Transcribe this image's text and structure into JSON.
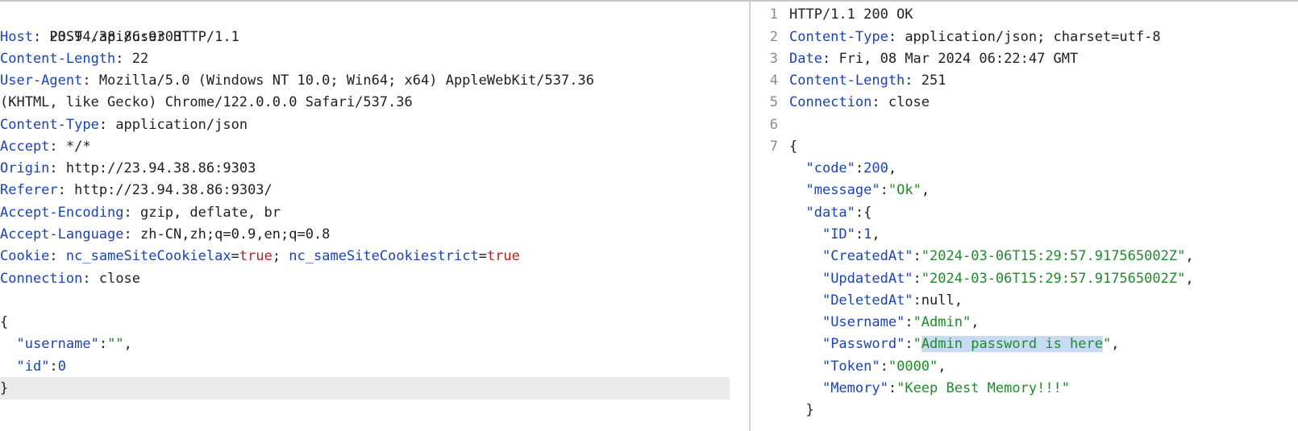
{
  "request": {
    "request_line": "POST /api/user HTTP/1.1",
    "headers": [
      {
        "name": "Host",
        "value": "23.94.38.86:9303"
      },
      {
        "name": "Content-Length",
        "value": "22"
      },
      {
        "name": "User-Agent",
        "value": "Mozilla/5.0 (Windows NT 10.0; Win64; x64) AppleWebKit/537.36"
      },
      {
        "name": "",
        "value": "(KHTML, like Gecko) Chrome/122.0.0.0 Safari/537.36"
      },
      {
        "name": "Content-Type",
        "value": "application/json"
      },
      {
        "name": "Accept",
        "value": "*/*"
      },
      {
        "name": "Origin",
        "value": "http://23.94.38.86:9303"
      },
      {
        "name": "Referer",
        "value": "http://23.94.38.86:9303/"
      },
      {
        "name": "Accept-Encoding",
        "value": "gzip, deflate, br"
      },
      {
        "name": "Accept-Language",
        "value": "zh-CN,zh;q=0.9,en;q=0.8"
      },
      {
        "name": "Cookie",
        "value": ""
      },
      {
        "name": "Connection",
        "value": "close"
      }
    ],
    "cookies": [
      {
        "key": "nc_sameSiteCookielax",
        "value": "true"
      },
      {
        "key": "nc_sameSiteCookiestrict",
        "value": "true"
      }
    ],
    "body": {
      "open_brace": "{",
      "username_key": "\"username\"",
      "username_value": "\"\"",
      "id_key": "\"id\"",
      "id_value": "0",
      "close_brace": "}"
    }
  },
  "response": {
    "line_numbers": [
      "1",
      "2",
      "3",
      "4",
      "5",
      "6",
      "7"
    ],
    "status_line": "HTTP/1.1 200 OK",
    "headers": [
      {
        "name": "Content-Type",
        "value": "application/json; charset=utf-8"
      },
      {
        "name": "Date",
        "value": "Fri, 08 Mar 2024 06:22:47 GMT"
      },
      {
        "name": "Content-Length",
        "value": "251"
      },
      {
        "name": "Connection",
        "value": "close"
      }
    ],
    "body": {
      "open_brace": "{",
      "code_key": "\"code\"",
      "code_value": "200",
      "message_key": "\"message\"",
      "message_value": "\"Ok\"",
      "data_key": "\"data\"",
      "data_open": "{",
      "fields": [
        {
          "key": "\"ID\"",
          "value": "1",
          "type": "num"
        },
        {
          "key": "\"CreatedAt\"",
          "value": "\"2024-03-06T15:29:57.917565002Z\"",
          "type": "str"
        },
        {
          "key": "\"UpdatedAt\"",
          "value": "\"2024-03-06T15:29:57.917565002Z\"",
          "type": "str"
        },
        {
          "key": "\"DeletedAt\"",
          "value": "null",
          "type": "null"
        },
        {
          "key": "\"Username\"",
          "value": "\"Admin\"",
          "type": "str"
        },
        {
          "key": "\"Password\"",
          "value": "Admin password is here",
          "type": "sel"
        },
        {
          "key": "\"Token\"",
          "value": "\"0000\"",
          "type": "str"
        },
        {
          "key": "\"Memory\"",
          "value": "\"Keep Best Memory!!!\"",
          "type": "str"
        }
      ],
      "data_close": "}"
    }
  },
  "colors": {
    "header_name": "#1a43b5",
    "string_value": "#1f8a2a",
    "cookie_value": "#b52323",
    "selection": "#c7dcf2",
    "highlight_line": "#ebebeb"
  }
}
